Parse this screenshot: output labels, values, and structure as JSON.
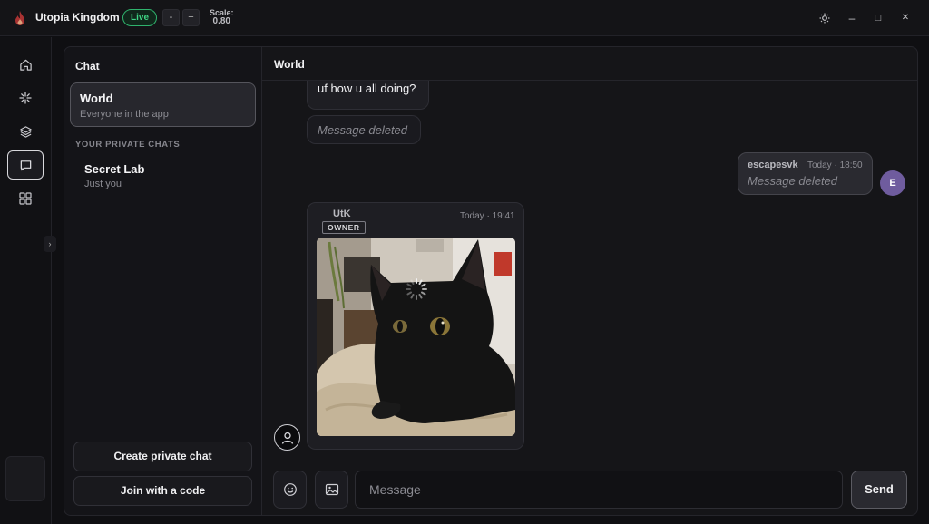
{
  "app": {
    "title": "Utopia Kingdom",
    "status_badge": "Live",
    "scale_decrease": "-",
    "scale_increase": "+",
    "scale_label": "Scale:",
    "scale_value": "0.80"
  },
  "window_controls": {
    "theme_icon": "sun-icon",
    "minimize": "–",
    "maximize": "□",
    "close": "✕"
  },
  "rail": {
    "items": [
      {
        "name": "home",
        "icon": "home-icon",
        "active": false
      },
      {
        "name": "activity",
        "icon": "sparkle-icon",
        "active": false
      },
      {
        "name": "layers",
        "icon": "layers-icon",
        "active": false
      },
      {
        "name": "chat",
        "icon": "chat-icon",
        "active": true
      },
      {
        "name": "apps",
        "icon": "grid-icon",
        "active": false
      }
    ],
    "collapse_glyph": "›"
  },
  "chat_panel": {
    "title": "Chat",
    "world": {
      "name": "World",
      "subtitle": "Everyone in the app"
    },
    "private_section_label": "YOUR PRIVATE CHATS",
    "private_chats": [
      {
        "name": "Secret Lab",
        "subtitle": "Just you"
      }
    ],
    "create_button": "Create private chat",
    "join_button": "Join with a code"
  },
  "conversation": {
    "title": "World",
    "messages": [
      {
        "text": "uf how u all doing?"
      },
      {
        "deleted_text": "Message deleted"
      },
      {
        "author": "escapesvk",
        "time": "Today · 18:50",
        "deleted_text": "Message deleted",
        "avatar_letter": "E"
      },
      {
        "author": "UtK",
        "role": "OWNER",
        "time": "Today · 19:41",
        "attachment": "photo of a black kitten"
      }
    ]
  },
  "composer": {
    "emoji_icon": "smile-icon",
    "image_icon": "image-icon",
    "placeholder": "Message",
    "send_label": "Send"
  },
  "colors": {
    "background": "#0f0f12",
    "panel": "#141418",
    "live_green": "#3fd584",
    "avatar_purple": "#6f5c9e"
  }
}
